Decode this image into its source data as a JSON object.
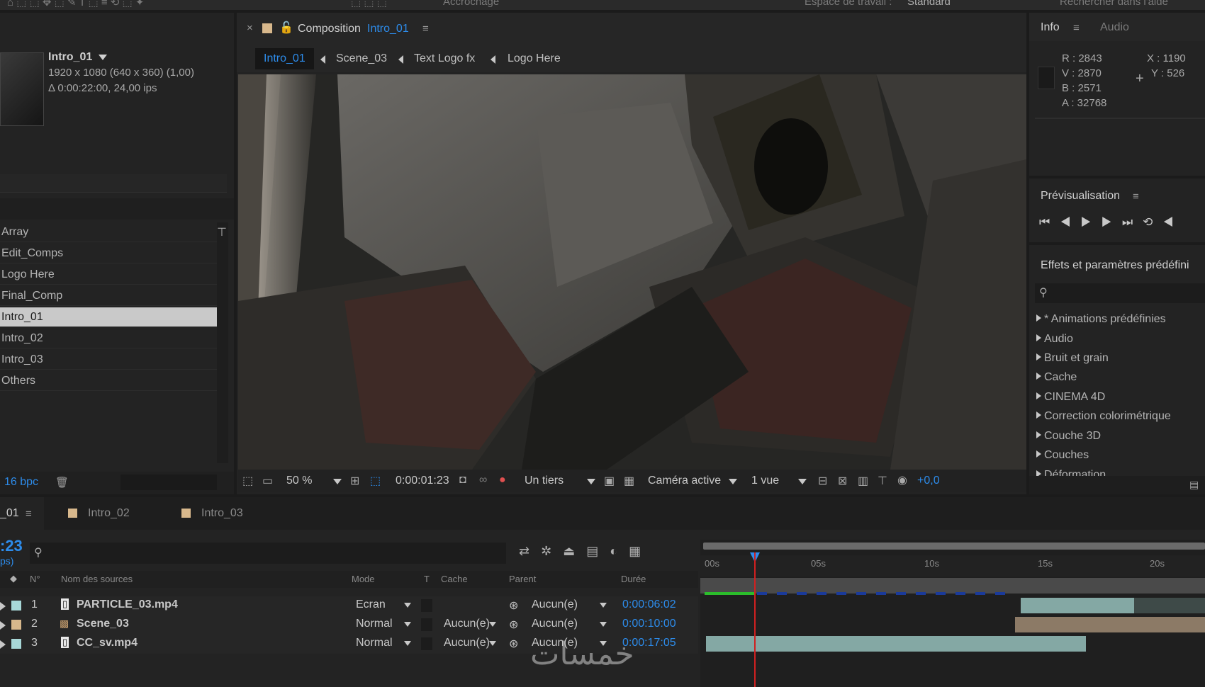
{
  "topbar": {
    "workspace_label": "Espace de travail :",
    "workspace_value": "Standard",
    "search_label": "Rechercher dans l'aide",
    "snapping_label": "Accrochage"
  },
  "project": {
    "selected_name": "Intro_01",
    "dims": "1920 x 1080  (640 x 360) (1,00)",
    "duration": "Δ 0:00:22:00, 24,00 ips",
    "items": [
      "Array",
      "Edit_Comps",
      "Logo Here",
      "Final_Comp",
      "Intro_01",
      "Intro_02",
      "Intro_03",
      "Others"
    ],
    "selected_index": 4,
    "bpc": "16 bpc"
  },
  "comp": {
    "panel_label": "Composition",
    "panel_comp": "Intro_01",
    "breadcrumbs": [
      "Intro_01",
      "Scene_03",
      "Text Logo fx",
      "Logo Here"
    ],
    "zoom": "50 %",
    "timecode": "0:00:01:23",
    "resolution": "Un tiers",
    "camera": "Caméra active",
    "views": "1 vue",
    "exposure": "+0,0"
  },
  "info": {
    "tab_info": "Info",
    "tab_audio": "Audio",
    "r": "R : 2843",
    "v": "V : 2870",
    "b": "B : 2571",
    "a": "A : 32768",
    "x": "X : 1190",
    "y": "Y : 526"
  },
  "preview": {
    "title": "Prévisualisation"
  },
  "effects": {
    "title": "Effets et paramètres prédéfini",
    "items": [
      "* Animations prédéfinies",
      "Audio",
      "Bruit et grain",
      "Cache",
      "CINEMA 4D",
      "Correction colorimétrique",
      "Couche 3D",
      "Couches",
      "Déformation"
    ]
  },
  "timeline": {
    "tabs": [
      "_01",
      "Intro_02",
      "Intro_03"
    ],
    "current_time": ":23",
    "fps_fragment": "ps)",
    "headers": {
      "num": "N°",
      "name": "Nom des sources",
      "mode": "Mode",
      "t": "T",
      "cache": "Cache",
      "parent": "Parent",
      "duration": "Durée"
    },
    "ruler": [
      "00s",
      "05s",
      "10s",
      "15s",
      "20s"
    ],
    "layers": [
      {
        "num": "1",
        "name": "PARTICLE_03.mp4",
        "mode": "Ecran",
        "cache": "",
        "parent": "Aucun(e)",
        "duration": "0:00:06:02",
        "color": "#a8d8d8"
      },
      {
        "num": "2",
        "name": "Scene_03",
        "mode": "Normal",
        "cache": "Aucun(e)",
        "parent": "Aucun(e)",
        "duration": "0:00:10:00",
        "color": "#d8b88c"
      },
      {
        "num": "3",
        "name": "CC_sv.mp4",
        "mode": "Normal",
        "cache": "Aucun(e)",
        "parent": "Aucun(e)",
        "duration": "0:00:17:05",
        "color": "#a8d8d8"
      }
    ]
  },
  "watermark": "خمسات"
}
